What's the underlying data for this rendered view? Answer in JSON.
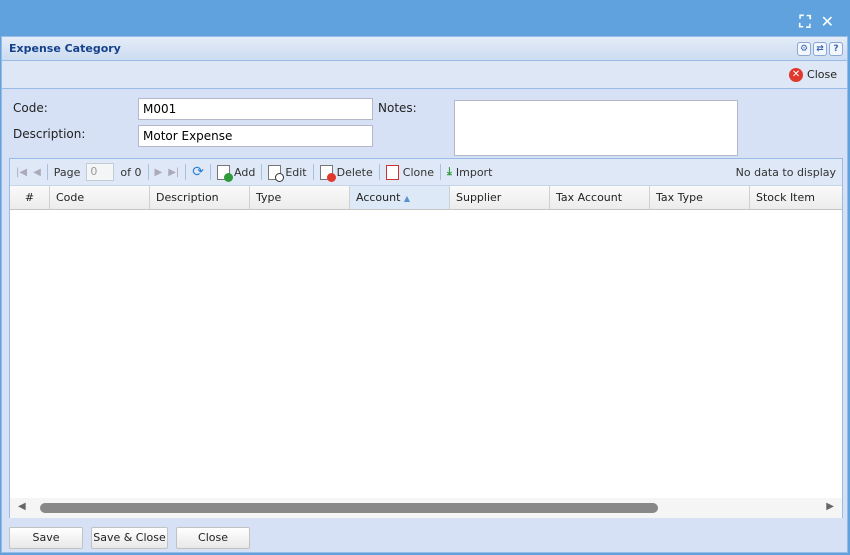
{
  "window": {
    "title": "Expense Category",
    "close_label": "Close"
  },
  "form": {
    "code_label": "Code:",
    "code_value": "M001",
    "description_label": "Description:",
    "description_value": "Motor Expense",
    "notes_label": "Notes:",
    "notes_value": ""
  },
  "grid": {
    "page_label": "Page",
    "page_value": "0",
    "of_label": "of 0",
    "add": "Add",
    "edit": "Edit",
    "delete": "Delete",
    "clone": "Clone",
    "import": "Import",
    "status": "No data to display",
    "columns": [
      "#",
      "Code",
      "Description",
      "Type",
      "Account",
      "Supplier",
      "Tax Account",
      "Tax Type",
      "Stock Item"
    ],
    "sorted_column": "Account"
  },
  "footer": {
    "save": "Save",
    "save_close": "Save & Close",
    "close": "Close"
  }
}
